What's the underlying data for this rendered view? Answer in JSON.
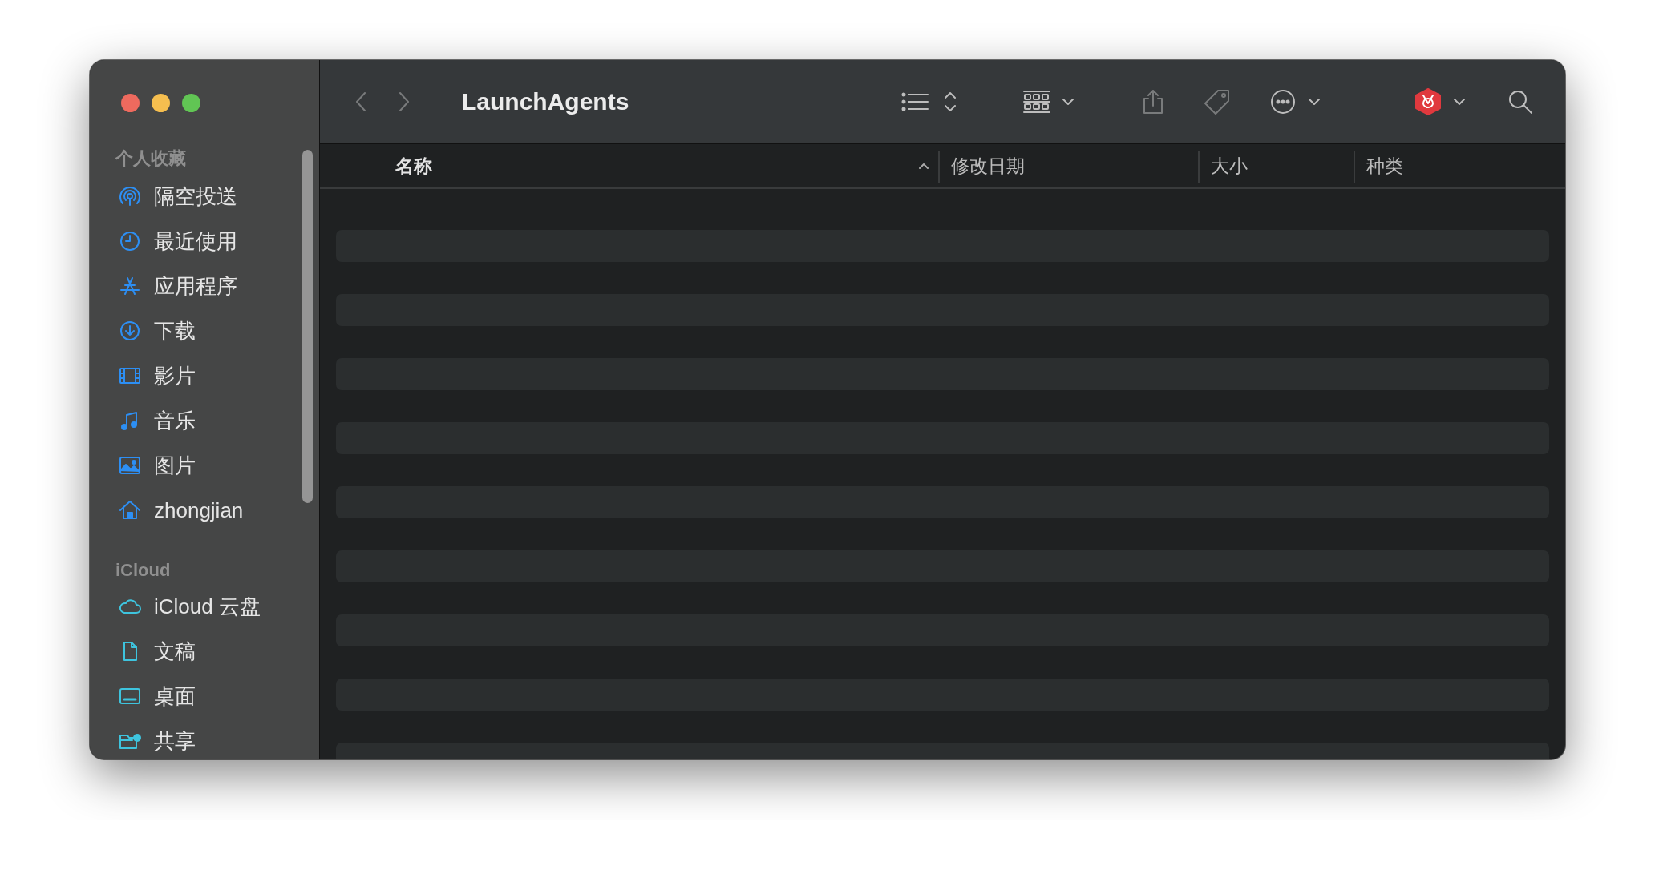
{
  "window": {
    "title": "LaunchAgents"
  },
  "toolbar": [
    {
      "kind": "back",
      "disabled": true
    },
    {
      "kind": "forward",
      "disabled": true
    },
    {
      "kind": "list-view",
      "disabled": false
    },
    {
      "kind": "group",
      "disabled": false
    },
    {
      "kind": "share",
      "disabled": true
    },
    {
      "kind": "tag",
      "disabled": true
    },
    {
      "kind": "more",
      "disabled": false
    },
    {
      "kind": "app",
      "disabled": false
    },
    {
      "kind": "search",
      "disabled": false
    }
  ],
  "sidebar": {
    "sections": [
      {
        "title": "个人收藏",
        "items": [
          {
            "kind": "airdrop",
            "label": "隔空投送"
          },
          {
            "kind": "recents",
            "label": "最近使用"
          },
          {
            "kind": "apps",
            "label": "应用程序"
          },
          {
            "kind": "downloads",
            "label": "下载"
          },
          {
            "kind": "movies",
            "label": "影片"
          },
          {
            "kind": "music",
            "label": "音乐"
          },
          {
            "kind": "pictures",
            "label": "图片"
          },
          {
            "kind": "home",
            "label": "zhongjian"
          }
        ]
      },
      {
        "title": "iCloud",
        "items": [
          {
            "kind": "cloud",
            "label": "iCloud 云盘"
          },
          {
            "kind": "document",
            "label": "文稿"
          },
          {
            "kind": "desktop",
            "label": "桌面"
          },
          {
            "kind": "shared",
            "label": "共享"
          }
        ]
      }
    ]
  },
  "table": {
    "columns": [
      {
        "label": "名称",
        "sorted": true
      },
      {
        "label": "修改日期",
        "sorted": false
      },
      {
        "label": "大小",
        "sorted": false
      },
      {
        "label": "种类",
        "sorted": false
      }
    ]
  }
}
